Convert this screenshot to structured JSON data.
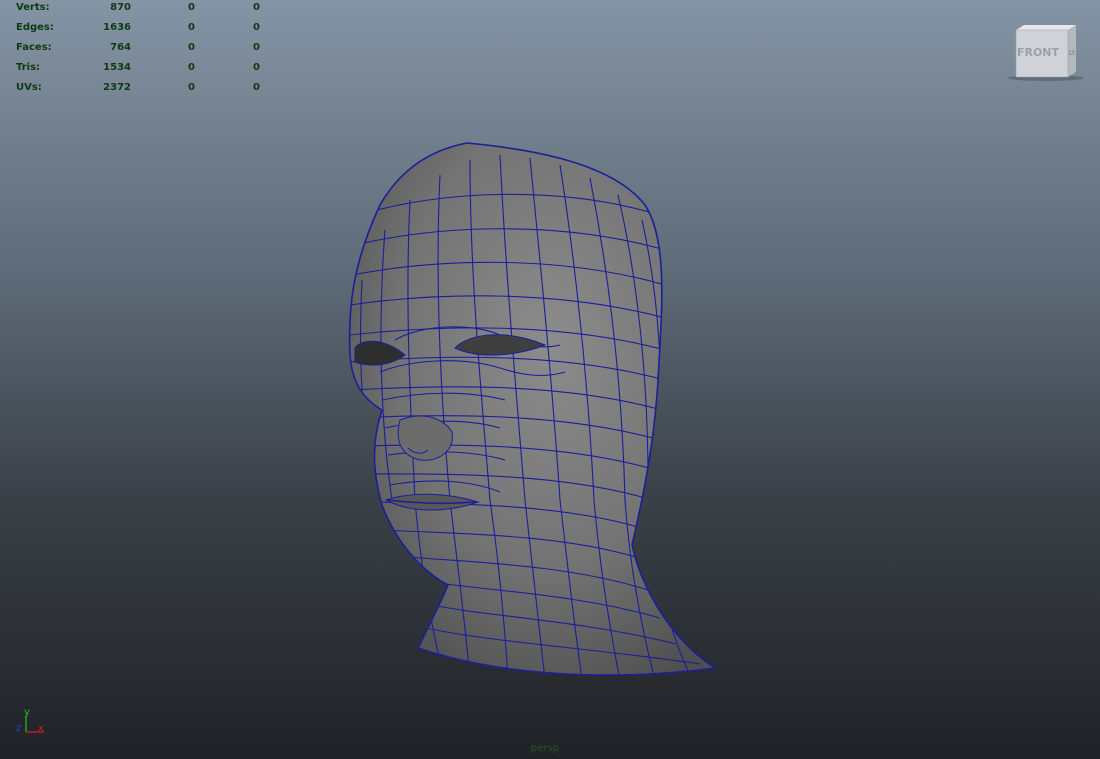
{
  "hud": {
    "rows": [
      {
        "label": "Verts:",
        "v1": "870",
        "v2": "0",
        "v3": "0"
      },
      {
        "label": "Edges:",
        "v1": "1636",
        "v2": "0",
        "v3": "0"
      },
      {
        "label": "Faces:",
        "v1": "764",
        "v2": "0",
        "v3": "0"
      },
      {
        "label": "Tris:",
        "v1": "1534",
        "v2": "0",
        "v3": "0"
      },
      {
        "label": "UVs:",
        "v1": "2372",
        "v2": "0",
        "v3": "0"
      }
    ]
  },
  "viewcube": {
    "front_label": "FRONT",
    "side_label": "LT"
  },
  "axis": {
    "y_label": "y",
    "x_label": "x",
    "z_label": "z"
  },
  "camera_label": "persp",
  "colors": {
    "wire": "#1b1f9a",
    "mesh": "#7b7b7b",
    "hud_text": "#0e3a12",
    "axis_x": "#d02020",
    "axis_y": "#20c020",
    "axis_z": "#2040d0"
  }
}
